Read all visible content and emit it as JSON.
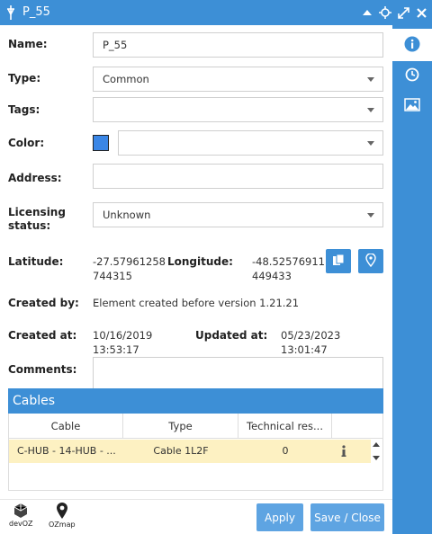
{
  "window": {
    "title": "P_55"
  },
  "form": {
    "name_label": "Name:",
    "name_value": "P_55",
    "type_label": "Type:",
    "type_value": "Common",
    "tags_label": "Tags:",
    "tags_value": "",
    "color_label": "Color:",
    "color_swatch": "#3a86e6",
    "color_value": "",
    "address_label": "Address:",
    "address_value": "",
    "licensing_label_1": "Licensing",
    "licensing_label_2": "status:",
    "licensing_value": "Unknown",
    "latitude_label": "Latitude:",
    "latitude_value_1": "-27.57961258",
    "latitude_value_2": "744315",
    "longitude_label": "Longitude:",
    "longitude_value_1": "-48.52576911",
    "longitude_value_2": "449433",
    "created_by_label": "Created by:",
    "created_by_value": "Element created before version 1.21.21",
    "created_at_label": "Created at:",
    "created_at_date": "10/16/2019",
    "created_at_time": "13:53:17",
    "updated_at_label": "Updated at:",
    "updated_at_date": "05/23/2023",
    "updated_at_time": "13:01:47",
    "comments_label": "Comments:",
    "comments_value": ""
  },
  "cables": {
    "title": "Cables",
    "headers": [
      "Cable",
      "Type",
      "Technical res..."
    ],
    "rows": [
      {
        "cable": "C-HUB - 14-HUB - ...",
        "type": "Cable 1L2F",
        "technical": "0"
      }
    ]
  },
  "footer": {
    "logo1": "devOZ",
    "logo2": "OZmap",
    "apply": "Apply",
    "save_close": "Save / Close"
  },
  "colors": {
    "accent": "#3d8fd6",
    "button": "#5ea4e2",
    "row_highlight": "#fdf1c2"
  }
}
